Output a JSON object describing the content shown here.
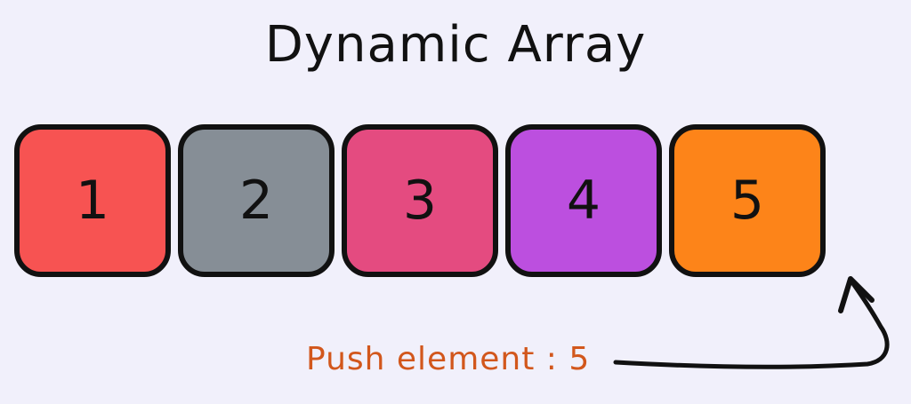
{
  "diagram": {
    "title": "Dynamic Array",
    "cells": [
      {
        "label": "1",
        "color": "#f75352"
      },
      {
        "label": "2",
        "color": "#868e96"
      },
      {
        "label": "3",
        "color": "#e44b80"
      },
      {
        "label": "4",
        "color": "#bc4fdf"
      },
      {
        "label": "5",
        "color": "#fd8419"
      }
    ],
    "push_label": "Push element : 5",
    "push_label_color": "#d2571c",
    "background": "#f1f0fb"
  }
}
